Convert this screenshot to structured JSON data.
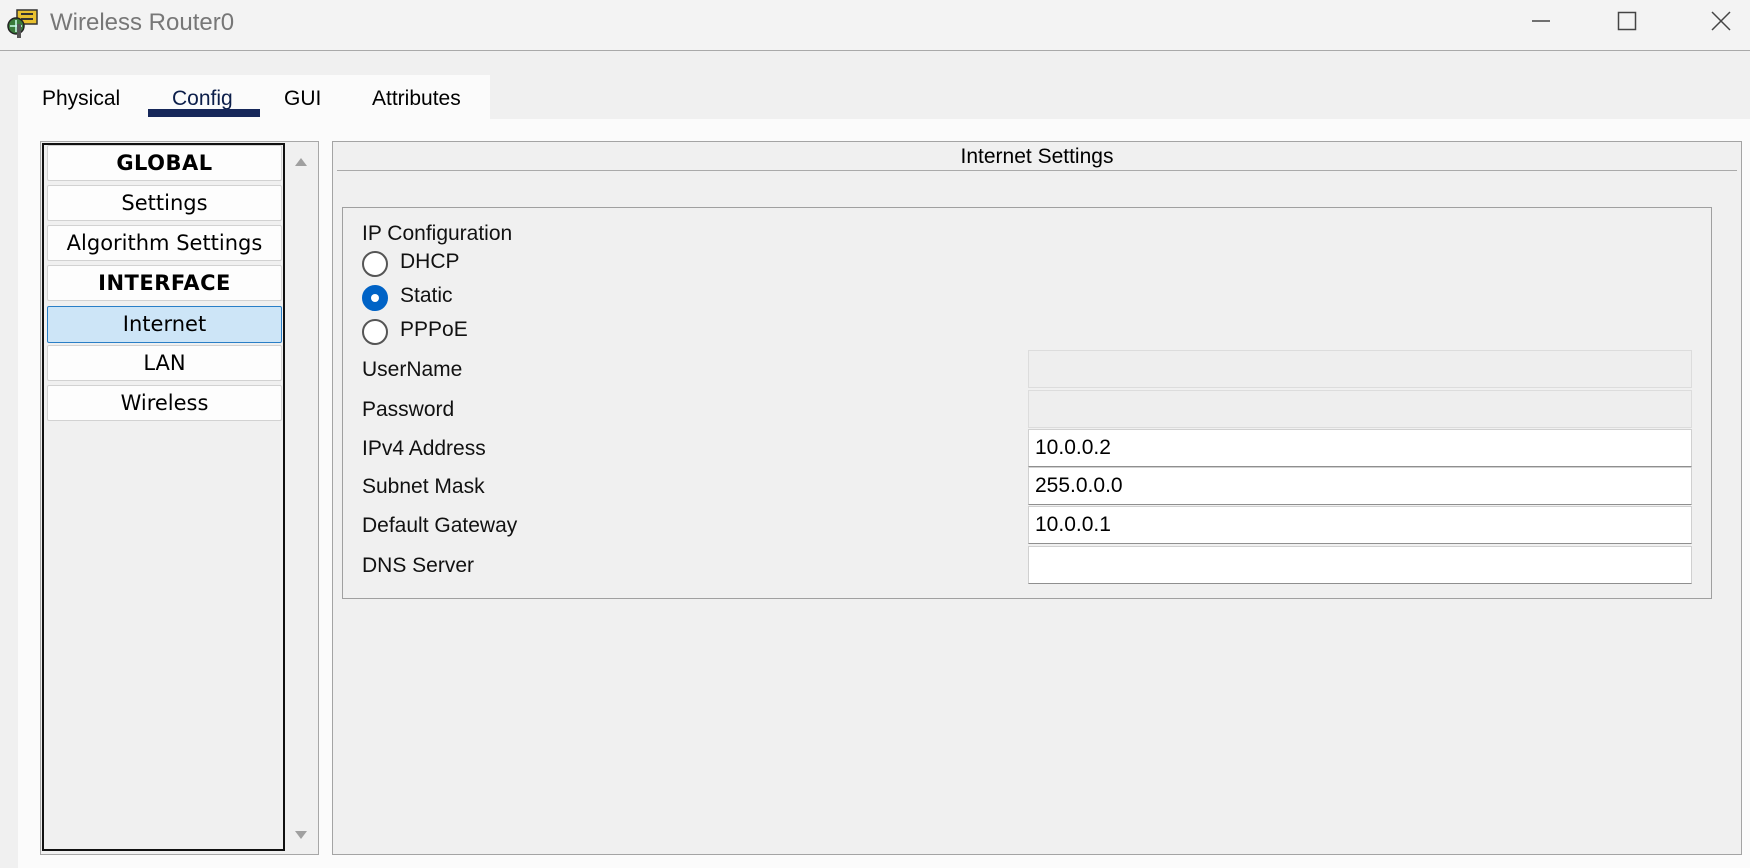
{
  "window": {
    "title": "Wireless Router0",
    "icon": "router-app-icon",
    "controls": [
      "minimize-icon",
      "maximize-icon",
      "close-icon"
    ]
  },
  "tabs": {
    "items": [
      "Physical",
      "Config",
      "GUI",
      "Attributes"
    ],
    "selected": "Config"
  },
  "sidebar": {
    "items": [
      {
        "label": "GLOBAL",
        "type": "header"
      },
      {
        "label": "Settings",
        "type": "item"
      },
      {
        "label": "Algorithm Settings",
        "type": "item"
      },
      {
        "label": "INTERFACE",
        "type": "header"
      },
      {
        "label": "Internet",
        "type": "item",
        "selected": true
      },
      {
        "label": "LAN",
        "type": "item"
      },
      {
        "label": "Wireless",
        "type": "item"
      }
    ]
  },
  "main": {
    "title": "Internet Settings",
    "ip_config": {
      "title": "IP Configuration",
      "options": [
        "DHCP",
        "Static",
        "PPPoE"
      ],
      "selected": "Static"
    },
    "fields": {
      "username": {
        "label": "UserName",
        "value": "",
        "enabled": false
      },
      "password": {
        "label": "Password",
        "value": "",
        "enabled": false
      },
      "ipv4": {
        "label": "IPv4 Address",
        "value": "10.0.0.2"
      },
      "subnet": {
        "label": "Subnet Mask",
        "value": "255.0.0.0"
      },
      "gateway": {
        "label": "Default Gateway",
        "value": "10.0.0.1"
      },
      "dns": {
        "label": "DNS Server",
        "value": ""
      }
    }
  },
  "colors": {
    "accent": "#16275a",
    "selection": "#cde5f7",
    "radio_checked": "#0063c6"
  }
}
